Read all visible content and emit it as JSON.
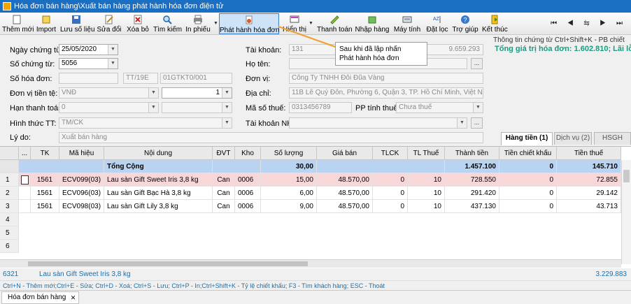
{
  "window": {
    "title": "Hóa đơn bán hàng\\Xuất bán hàng phát hành hóa đơn điện tử"
  },
  "toolbar": {
    "items": [
      {
        "label": "Thêm mới",
        "icon": "new-doc-icon"
      },
      {
        "label": "Import",
        "icon": "import-icon"
      },
      {
        "label": "Lưu số liệu",
        "icon": "save-icon"
      },
      {
        "label": "Sửa đổi",
        "icon": "edit-icon"
      },
      {
        "label": "Xóa bỏ",
        "icon": "delete-icon"
      },
      {
        "label": "Tìm kiếm",
        "icon": "search-icon"
      },
      {
        "label": "In phiếu",
        "icon": "printer-icon"
      },
      {
        "label": "Phát hành hóa đơn",
        "icon": "publish-icon"
      },
      {
        "label": "Hiển thị",
        "icon": "display-icon"
      },
      {
        "label": "Thanh toán",
        "icon": "payment-icon"
      },
      {
        "label": "Nhập hàng",
        "icon": "import-goods-icon"
      },
      {
        "label": "Máy tính",
        "icon": "calculator-icon"
      },
      {
        "label": "Đặt lọc",
        "icon": "filter-icon"
      },
      {
        "label": "Trợ giúp",
        "icon": "help-icon"
      },
      {
        "label": "Kết thúc",
        "icon": "exit-icon"
      }
    ],
    "nav": "⏮ ◀ ⇆ ▶ ⏭"
  },
  "callout": {
    "line1": "Sau khi đã lập nhấn",
    "line2": "Phát hành hóa đơn"
  },
  "form": {
    "ngay_chung_tu": {
      "label": "Ngày chứng từ:",
      "value": "25/05/2020"
    },
    "so_chung_tu": {
      "label": "Số chứng từ:",
      "value": "5056"
    },
    "so_hoa_don": {
      "label": "Số hóa đơn:",
      "value": "",
      "serial": "TT/19E",
      "template": "01GTKT0/001"
    },
    "don_vi_tien_te": {
      "label": "Đơn vị tiền tệ:",
      "value": "VNĐ",
      "rate": "1"
    },
    "han_thanh_toan": {
      "label": "Hạn thanh toán:",
      "value": "0"
    },
    "hinh_thuc_tt": {
      "label": "Hình thức TT:",
      "value": "TM/CK"
    },
    "ly_do": {
      "label": "Lý do:",
      "value": "Xuất bán hàng"
    },
    "tai_khoan": {
      "label": "Tài khoản:",
      "value": "131",
      "balance": "9.659.293"
    },
    "ho_ten": {
      "label": "Họ tên:",
      "value": ""
    },
    "don_vi": {
      "label": "Đơn vị:",
      "value": "Công Ty TNHH Đôi Đũa Vàng"
    },
    "dia_chi": {
      "label": "Địa chỉ:",
      "value": "11B Lê Quý Đôn, Phường 6, Quận 3, TP. Hồ Chí Minh, Việt Nam"
    },
    "ma_so_thue": {
      "label": "Mã số thuế:",
      "value": "0313456789"
    },
    "pp_tinh_thue": {
      "label": "PP tính thuế:",
      "value": "Chưa thuế"
    },
    "tai_khoan_nh": {
      "label": "Tài khoản NH:",
      "value": ""
    }
  },
  "info": {
    "hint": "Thông tin chứng từ Ctrl+Shift+K - PB chiết",
    "total": "Tổng giá trị hóa đơn: 1.602.810; Lãi lỗ:"
  },
  "tabs": [
    {
      "label": "Hàng tiền (1)",
      "active": true
    },
    {
      "label": "Dịch vụ (2)",
      "active": false
    },
    {
      "label": "HSGH",
      "active": false
    }
  ],
  "grid": {
    "headers": [
      "...",
      "TK",
      "Mã hiệu",
      "Nội dung",
      "ĐVT",
      "Kho",
      "Số lượng",
      "Giá bán",
      "TLCK",
      "TL Thuế",
      "Thành tiền",
      "Tiền chiết khấu",
      "Tiền thuế"
    ],
    "total": {
      "label": "Tổng Cộng",
      "so_luong": "30,00",
      "thanh_tien": "1.457.100",
      "tien_ck": "0",
      "tien_thue": "145.710"
    },
    "rows": [
      {
        "n": "1",
        "tk": "1561",
        "ma": "ECV099(03)",
        "nd": "Lau sàn Gift Sweet Iris 3,8 kg",
        "dvt": "Can",
        "kho": "0006",
        "sl": "15,00",
        "gia": "48.570,00",
        "tlck": "0",
        "tlt": "10",
        "tt": "728.550",
        "ck": "0",
        "thue": "72.855"
      },
      {
        "n": "2",
        "tk": "1561",
        "ma": "ECV096(03)",
        "nd": "Lau sàn Gift Bạc Hà 3,8 kg",
        "dvt": "Can",
        "kho": "0006",
        "sl": "6,00",
        "gia": "48.570,00",
        "tlck": "0",
        "tlt": "10",
        "tt": "291.420",
        "ck": "0",
        "thue": "29.142"
      },
      {
        "n": "3",
        "tk": "1561",
        "ma": "ECV098(03)",
        "nd": "Lau sàn Gift Lily 3,8 kg",
        "dvt": "Can",
        "kho": "0006",
        "sl": "9,00",
        "gia": "48.570,00",
        "tlck": "0",
        "tlt": "10",
        "tt": "437.130",
        "ck": "0",
        "thue": "43.713"
      }
    ],
    "empty_rows": [
      "4",
      "5",
      "6"
    ]
  },
  "status": {
    "code": "6321",
    "item": "Lau sàn Gift Sweet Iris 3,8 kg",
    "value": "3.229.883",
    "shortcuts": "Ctrl+N - Thêm mới;Ctrl+E - Sửa; Ctrl+D - Xoá; Ctrl+S - Lưu; Ctrl+P - In;Ctrl+Shift+K - Tỷ lệ chiết khấu; F3 - Tìm khách hàng; ESC - Thoát"
  },
  "bottom_tab": {
    "label": "Hóa đơn bán hàng",
    "close": "✕"
  },
  "colors": {
    "titlebar": "#1a6fc2",
    "total_row": "#b9d3f2",
    "selected_row": "#f8d7d9",
    "info_total": "#1b9a80",
    "status_text": "#1b6fa8",
    "callout_line": "#f0a030"
  }
}
